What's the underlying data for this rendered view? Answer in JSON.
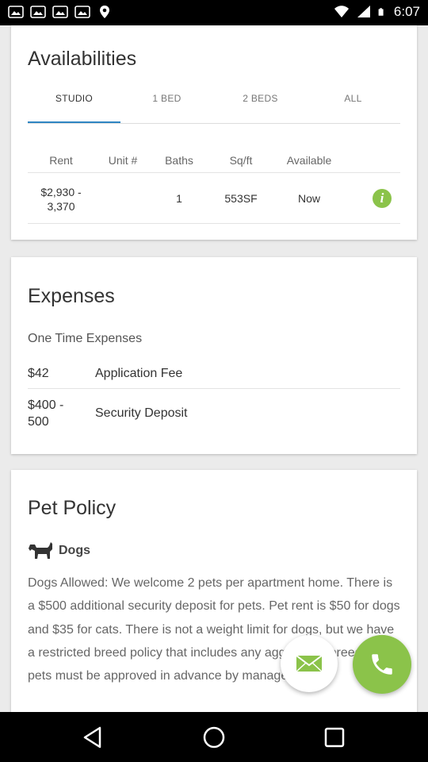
{
  "status_bar": {
    "time": "6:07",
    "left_icons": [
      "image-icon",
      "image-icon",
      "image-icon",
      "image-icon",
      "location-icon"
    ],
    "right_icons": [
      "wifi-icon",
      "signal-icon",
      "battery-icon"
    ]
  },
  "availabilities": {
    "title": "Availabilities",
    "tabs": [
      {
        "label": "STUDIO",
        "active": true
      },
      {
        "label": "1 BED",
        "active": false
      },
      {
        "label": "2 BEDS",
        "active": false
      },
      {
        "label": "ALL",
        "active": false
      }
    ],
    "columns": [
      "Rent",
      "Unit #",
      "Baths",
      "Sq/ft",
      "Available"
    ],
    "rows": [
      {
        "rent_line1": "$2,930 -",
        "rent_line2": "3,370",
        "unit": "",
        "baths": "1",
        "sqft": "553SF",
        "available": "Now"
      }
    ]
  },
  "expenses": {
    "title": "Expenses",
    "subheading": "One Time Expenses",
    "items": [
      {
        "amount_line1": "$42",
        "amount_line2": "",
        "label": "Application Fee"
      },
      {
        "amount_line1": "$400 -",
        "amount_line2": "500",
        "label": "Security Deposit"
      }
    ]
  },
  "pet_policy": {
    "title": "Pet Policy",
    "dogs_label": "Dogs",
    "dogs_text": "Dogs Allowed: We welcome 2 pets per apartment home. There is a $500 additional security deposit for pets. Pet rent is $50 for dogs and $35 for cats. There is not a weight limit for dogs, but we have a restricted breed policy that includes any aggressive breeds. All pets must be approved in advance by management."
  },
  "colors": {
    "accent_green": "#8bc34a",
    "tab_indicator": "#2e85c3"
  }
}
